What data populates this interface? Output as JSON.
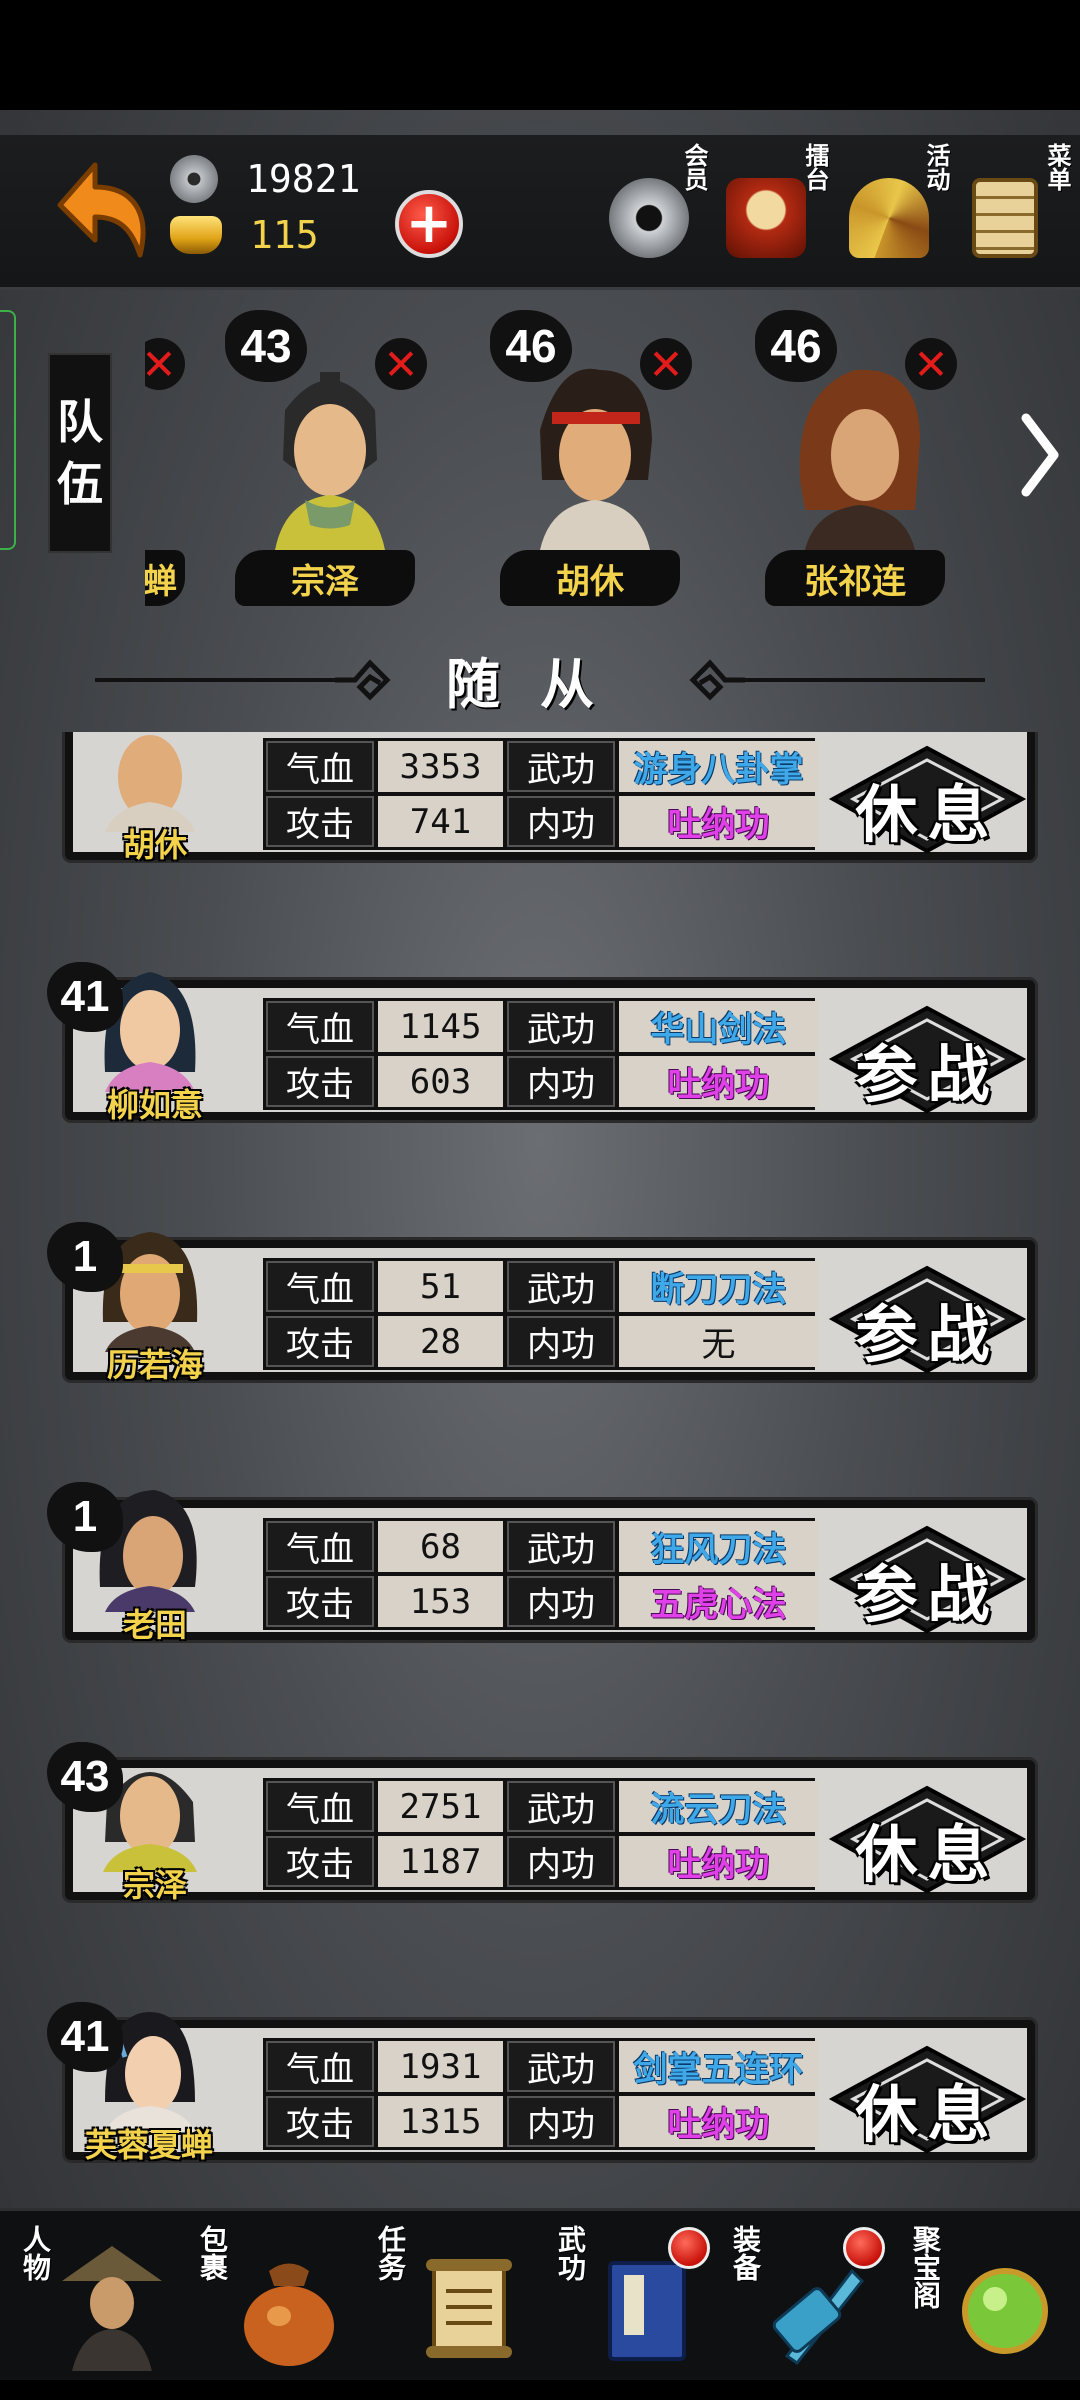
{
  "currency": {
    "silver": "19821",
    "gold": "115"
  },
  "top_menu": [
    {
      "label": "会员",
      "icon": "vip-coin-icon"
    },
    {
      "label": "擂台",
      "icon": "arena-drum-icon"
    },
    {
      "label": "活动",
      "icon": "activity-fan-icon"
    },
    {
      "label": "菜单",
      "icon": "menu-scroll-icon"
    }
  ],
  "team": {
    "tab_label": [
      "队",
      "伍"
    ],
    "partial_name": "蝉",
    "members": [
      {
        "level": "43",
        "name": "宗泽"
      },
      {
        "level": "46",
        "name": "胡休"
      },
      {
        "level": "46",
        "name": "张祁连"
      }
    ]
  },
  "section_title": "随从",
  "labels": {
    "hp": "气血",
    "atk": "攻击",
    "skill": "武功",
    "inner": "内功"
  },
  "followers": [
    {
      "level": "",
      "name": "胡休",
      "hp": "3353",
      "atk": "741",
      "skill": "游身八卦掌",
      "inner": "吐纳功",
      "action": "休息"
    },
    {
      "level": "41",
      "name": "柳如意",
      "hp": "1145",
      "atk": "603",
      "skill": "华山剑法",
      "inner": "吐纳功",
      "action": "参战"
    },
    {
      "level": "1",
      "name": "历若海",
      "hp": "51",
      "atk": "28",
      "skill": "断刀刀法",
      "inner": "无",
      "action": "参战"
    },
    {
      "level": "1",
      "name": "老田",
      "hp": "68",
      "atk": "153",
      "skill": "狂风刀法",
      "inner": "五虎心法",
      "action": "参战"
    },
    {
      "level": "43",
      "name": "宗泽",
      "hp": "2751",
      "atk": "1187",
      "skill": "流云刀法",
      "inner": "吐纳功",
      "action": "休息"
    },
    {
      "level": "41",
      "name": "芙蓉夏蝉",
      "hp": "1931",
      "atk": "1315",
      "skill": "剑掌五连环",
      "inner": "吐纳功",
      "action": "休息"
    }
  ],
  "bottom_nav": [
    {
      "label": "人物",
      "icon": "character-icon",
      "badge": false
    },
    {
      "label": "包裹",
      "icon": "bag-icon",
      "badge": false
    },
    {
      "label": "任务",
      "icon": "quest-scroll-icon",
      "badge": false
    },
    {
      "label": "武功",
      "icon": "martial-book-icon",
      "badge": true
    },
    {
      "label": "装备",
      "icon": "equipment-sword-icon",
      "badge": true
    },
    {
      "label": "聚宝阁",
      "icon": "treasure-orb-icon",
      "badge": false
    }
  ],
  "colors": {
    "gold_text": "#f3d24c",
    "skill_text": "#3fa8e8",
    "inner_text": "#e040e8",
    "close_red": "#e21b1b"
  }
}
